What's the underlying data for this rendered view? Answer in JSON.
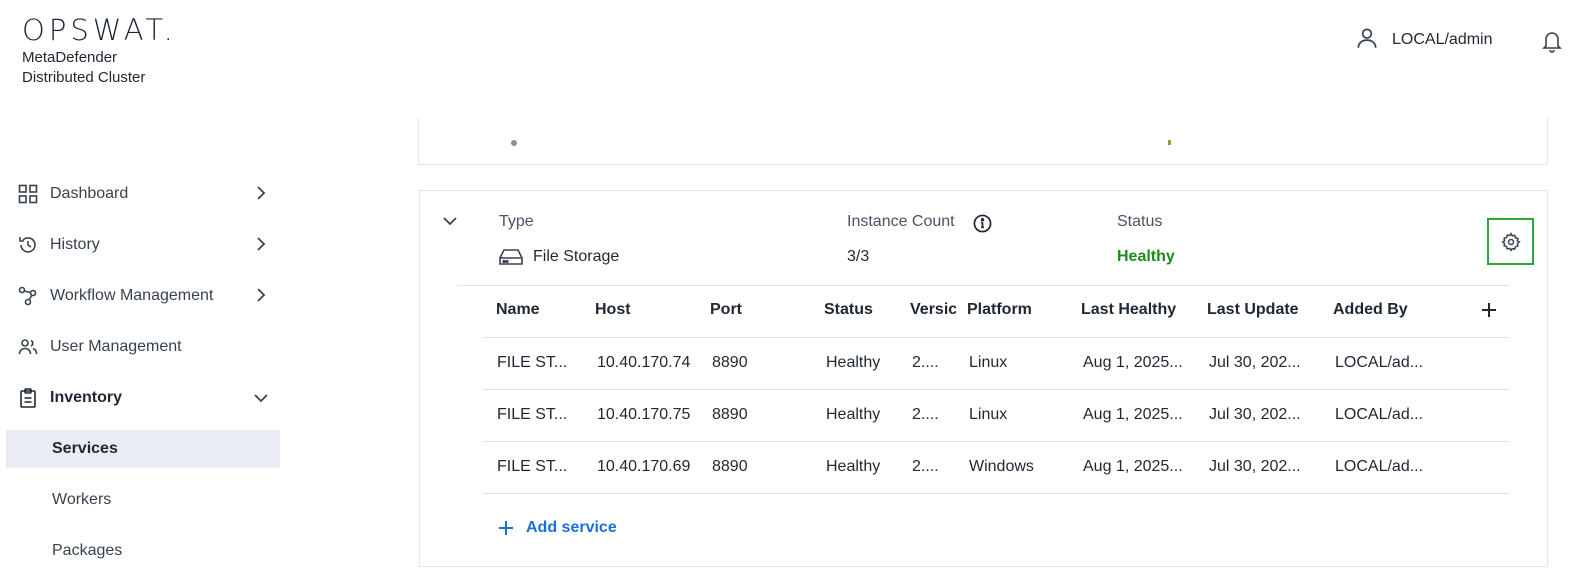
{
  "header": {
    "logo": "OPSWAT.",
    "product_line1": "MetaDefender",
    "product_line2": "Distributed Cluster",
    "user_name": "LOCAL/admin"
  },
  "sidebar": {
    "items": [
      {
        "label": "Dashboard",
        "icon": "grid-icon"
      },
      {
        "label": "History",
        "icon": "history-icon"
      },
      {
        "label": "Workflow Management",
        "icon": "workflow-icon"
      },
      {
        "label": "User Management",
        "icon": "users-icon"
      },
      {
        "label": "Inventory",
        "icon": "clipboard-icon"
      }
    ],
    "subitems": [
      {
        "label": "Services",
        "active": true
      },
      {
        "label": "Workers"
      },
      {
        "label": "Packages"
      }
    ]
  },
  "service_group": {
    "type_label": "Type",
    "type_value": "File Storage",
    "instance_label": "Instance Count",
    "instance_value": "3/3",
    "status_label": "Status",
    "status_value": "Healthy"
  },
  "table": {
    "columns": [
      "Name",
      "Host",
      "Port",
      "Status",
      "Versic",
      "Platform",
      "Last Healthy",
      "Last Update",
      "Added By"
    ],
    "rows": [
      {
        "name": "FILE ST...",
        "host": "10.40.170.74",
        "port": "8890",
        "status": "Healthy",
        "version": "2....",
        "platform": "Linux",
        "last_healthy": "Aug 1, 2025...",
        "last_update": "Jul 30, 202...",
        "added_by": "LOCAL/ad..."
      },
      {
        "name": "FILE ST...",
        "host": "10.40.170.75",
        "port": "8890",
        "status": "Healthy",
        "version": "2....",
        "platform": "Linux",
        "last_healthy": "Aug 1, 2025...",
        "last_update": "Jul 30, 202...",
        "added_by": "LOCAL/ad..."
      },
      {
        "name": "FILE ST...",
        "host": "10.40.170.69",
        "port": "8890",
        "status": "Healthy",
        "version": "2....",
        "platform": "Windows",
        "last_healthy": "Aug 1, 2025...",
        "last_update": "Jul 30, 202...",
        "added_by": "LOCAL/ad..."
      }
    ]
  },
  "add_service_label": "Add service",
  "colors": {
    "accent": "#1a6fd9",
    "healthy": "#1f8a1c",
    "focus": "#2ea43a"
  }
}
